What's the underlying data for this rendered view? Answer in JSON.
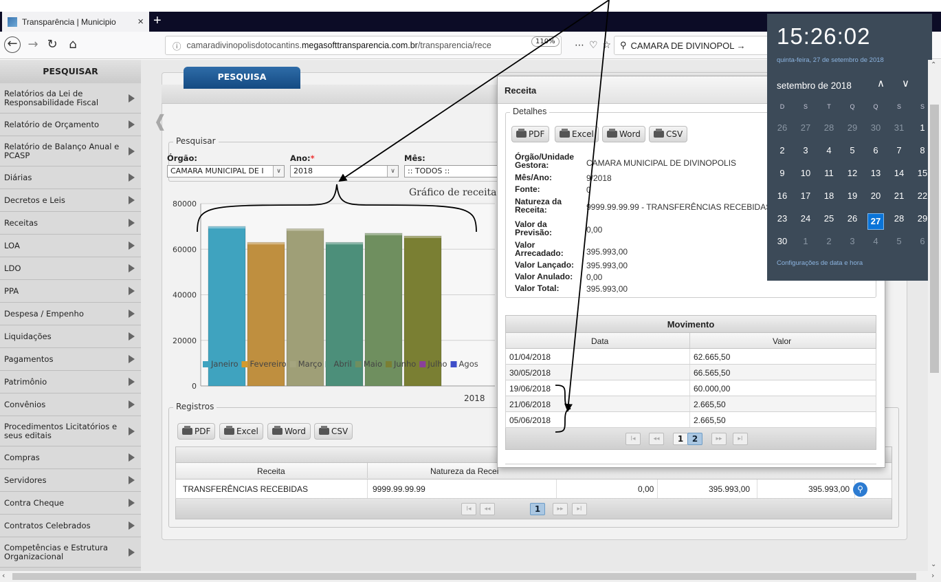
{
  "browser": {
    "tab_title": "Transparência | Municipio",
    "tab_close": "×",
    "new_tab": "+",
    "url_prefix": "camaradivinopolisdotocantins.",
    "url_domain": "megasofttransparencia.com.br",
    "url_path": "/transparencia/rece",
    "zoom": "110%",
    "search_text": "CAMARA DE DIVINOPOL →"
  },
  "sidebar": {
    "title": "PESQUISAR",
    "items": [
      {
        "label": "Relatórios da Lei de Responsabilidade Fiscal"
      },
      {
        "label": "Relatório de Orçamento"
      },
      {
        "label": "Relatório de Balanço Anual e PCASP"
      },
      {
        "label": "Diárias"
      },
      {
        "label": "Decretos e Leis"
      },
      {
        "label": "Receitas"
      },
      {
        "label": "LOA"
      },
      {
        "label": "LDO"
      },
      {
        "label": "PPA"
      },
      {
        "label": "Despesa / Empenho"
      },
      {
        "label": "Liquidações"
      },
      {
        "label": "Pagamentos"
      },
      {
        "label": "Patrimônio"
      },
      {
        "label": "Convênios"
      },
      {
        "label": "Procedimentos Licitatórios e seus editais"
      },
      {
        "label": "Compras"
      },
      {
        "label": "Servidores"
      },
      {
        "label": "Contra Cheque"
      },
      {
        "label": "Contratos Celebrados"
      },
      {
        "label": "Competências e Estrutura Organizacional"
      }
    ]
  },
  "main": {
    "tab_label": "PESQUISA",
    "filter_legend": "Pesquisar",
    "orgao_label": "Órgão:",
    "orgao_value": "CAMARA MUNICIPAL DE I",
    "ano_label": "Ano:",
    "ano_required": "*",
    "ano_value": "2018",
    "mes_label": "Mês:",
    "mes_value": ":: TODOS ::",
    "registros_legend": "Registros",
    "export_buttons": [
      "PDF",
      "Excel",
      "Word",
      "CSV"
    ],
    "table_columns": [
      "Receita",
      "Natureza da Recei"
    ],
    "table_row": {
      "receita": "TRANSFERÊNCIAS RECEBIDAS",
      "natureza": "9999.99.99.99",
      "previsao": "0,00",
      "arrecadado": "395.993,00",
      "total": "395.993,00"
    },
    "pager": {
      "first": "I◂",
      "prev": "◂◂",
      "page": "1",
      "next": "▸▸",
      "last": "▸I"
    }
  },
  "chart_data": {
    "type": "bar",
    "title": "Gráfico de receita",
    "categories": [
      "Janeiro",
      "Fevereiro",
      "Março",
      "Abril",
      "Maio",
      "Junho"
    ],
    "values": [
      70000,
      63000,
      69000,
      63000,
      67000,
      65800
    ],
    "colors": [
      "#3fa3bf",
      "#bf8f3f",
      "#9f9f77",
      "#4c8f7a",
      "#6f8f5f",
      "#7a7f33"
    ],
    "legend": [
      {
        "name": "Janeiro",
        "color": "#3fa3bf"
      },
      {
        "name": "Fevereiro",
        "color": "#d49a2e"
      },
      {
        "name": "Março",
        "color": "#a5a57f"
      },
      {
        "name": "Abril",
        "color": "#4c8f7a"
      },
      {
        "name": "Maio",
        "color": "#6f8f5f"
      },
      {
        "name": "Junho",
        "color": "#7a7f33"
      },
      {
        "name": "Julho",
        "color": "#8a3f9a"
      },
      {
        "name": "Agos",
        "color": "#3f4fc9"
      }
    ],
    "xlabel": "2018",
    "ylim": [
      0,
      80000
    ],
    "yticks": [
      0,
      20000,
      40000,
      60000,
      80000
    ],
    "ytick_labels": [
      "0",
      "20000",
      "40000",
      "60000",
      "80000"
    ],
    "grid": true,
    "legend_placement": "bottom"
  },
  "modal": {
    "title": "Receita",
    "details_legend": "Detalhes",
    "buttons": [
      "PDF",
      "Excel",
      "Word",
      "CSV"
    ],
    "fields": [
      {
        "label": "Órgão/Unidade Gestora:",
        "value": "CAMARA MUNICIPAL DE DIVINOPOLIS"
      },
      {
        "label": "Mês/Ano:",
        "value": "9/2018"
      },
      {
        "label": "Fonte:",
        "value": "0"
      },
      {
        "label": "Natureza da Receita:",
        "value": "9999.99.99.99 - TRANSFERÊNCIAS RECEBIDAS"
      },
      {
        "label": "Valor da Previsão:",
        "value": "0,00"
      },
      {
        "label": "Valor Arrecadado:",
        "value": "395.993,00"
      },
      {
        "label": "Valor Lançado:",
        "value": "395.993,00"
      },
      {
        "label": "Valor Anulado:",
        "value": "0,00"
      },
      {
        "label": "Valor Total:",
        "value": "395.993,00"
      }
    ],
    "movimento_title": "Movimento",
    "movimento_cols": [
      "Data",
      "Valor"
    ],
    "movimento_rows": [
      {
        "data": "01/04/2018",
        "valor": "62.665,50"
      },
      {
        "data": "30/05/2018",
        "valor": "66.565,50"
      },
      {
        "data": "19/06/2018",
        "valor": "60.000,00"
      },
      {
        "data": "21/06/2018",
        "valor": "2.665,50"
      },
      {
        "data": "05/06/2018",
        "valor": "2.665,50"
      }
    ],
    "pager": {
      "first": "I◂",
      "prev": "◂◂",
      "page1": "1",
      "page2": "2",
      "next": "▸▸",
      "last": "▸I"
    }
  },
  "calendar": {
    "time": "15:26:02",
    "date": "quinta-feira, 27 de setembro de 2018",
    "month": "setembro de 2018",
    "up": "^",
    "down": "v",
    "weekdays": [
      "D",
      "S",
      "T",
      "Q",
      "Q",
      "S",
      "S"
    ],
    "days": [
      [
        "26",
        "27",
        "28",
        "29",
        "30",
        "31",
        "1"
      ],
      [
        "2",
        "3",
        "4",
        "5",
        "6",
        "7",
        "8"
      ],
      [
        "9",
        "10",
        "11",
        "12",
        "13",
        "14",
        "15"
      ],
      [
        "16",
        "17",
        "18",
        "19",
        "20",
        "21",
        "22"
      ],
      [
        "23",
        "24",
        "25",
        "26",
        "27",
        "28",
        "29"
      ],
      [
        "30",
        "1",
        "2",
        "3",
        "4",
        "5",
        "6"
      ]
    ],
    "today": "27",
    "settings": "Configurações de data e hora"
  }
}
